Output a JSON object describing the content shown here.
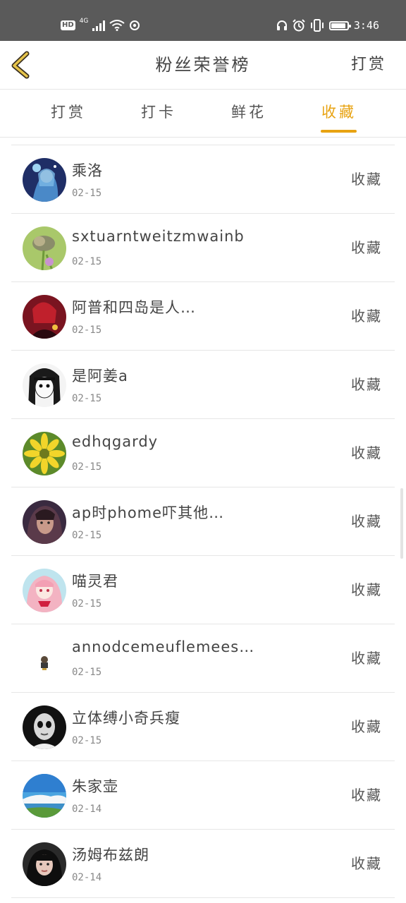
{
  "status_bar": {
    "hd": "HD",
    "network": "4G",
    "time": "3:46",
    "battery_level": 0.85
  },
  "header": {
    "title": "粉丝荣誉榜",
    "action": "打赏"
  },
  "tabs": [
    {
      "label": "打赏",
      "active": false
    },
    {
      "label": "打卡",
      "active": false
    },
    {
      "label": "鲜花",
      "active": false
    },
    {
      "label": "收藏",
      "active": true
    }
  ],
  "colors": {
    "accent": "#e8a312",
    "status_bar": "#5a5a5a"
  },
  "fans": [
    {
      "name": "乘洛",
      "date": "02-15",
      "action": "收藏"
    },
    {
      "name": "sxtuarntweitzmwainb",
      "date": "02-15",
      "action": "收藏"
    },
    {
      "name": "阿普和四岛是人…",
      "date": "02-15",
      "action": "收藏"
    },
    {
      "name": "是阿姜a",
      "date": "02-15",
      "action": "收藏"
    },
    {
      "name": "edhqgardy",
      "date": "02-15",
      "action": "收藏"
    },
    {
      "name": "ap时phome吓其他…",
      "date": "02-15",
      "action": "收藏"
    },
    {
      "name": "喵灵君",
      "date": "02-15",
      "action": "收藏"
    },
    {
      "name": "annodcemeuflemees…",
      "date": "02-15",
      "action": "收藏"
    },
    {
      "name": "立体缚小奇兵瘦",
      "date": "02-15",
      "action": "收藏"
    },
    {
      "name": "朱家壶",
      "date": "02-14",
      "action": "收藏"
    },
    {
      "name": "汤姆布兹朗",
      "date": "02-14",
      "action": "收藏"
    }
  ]
}
